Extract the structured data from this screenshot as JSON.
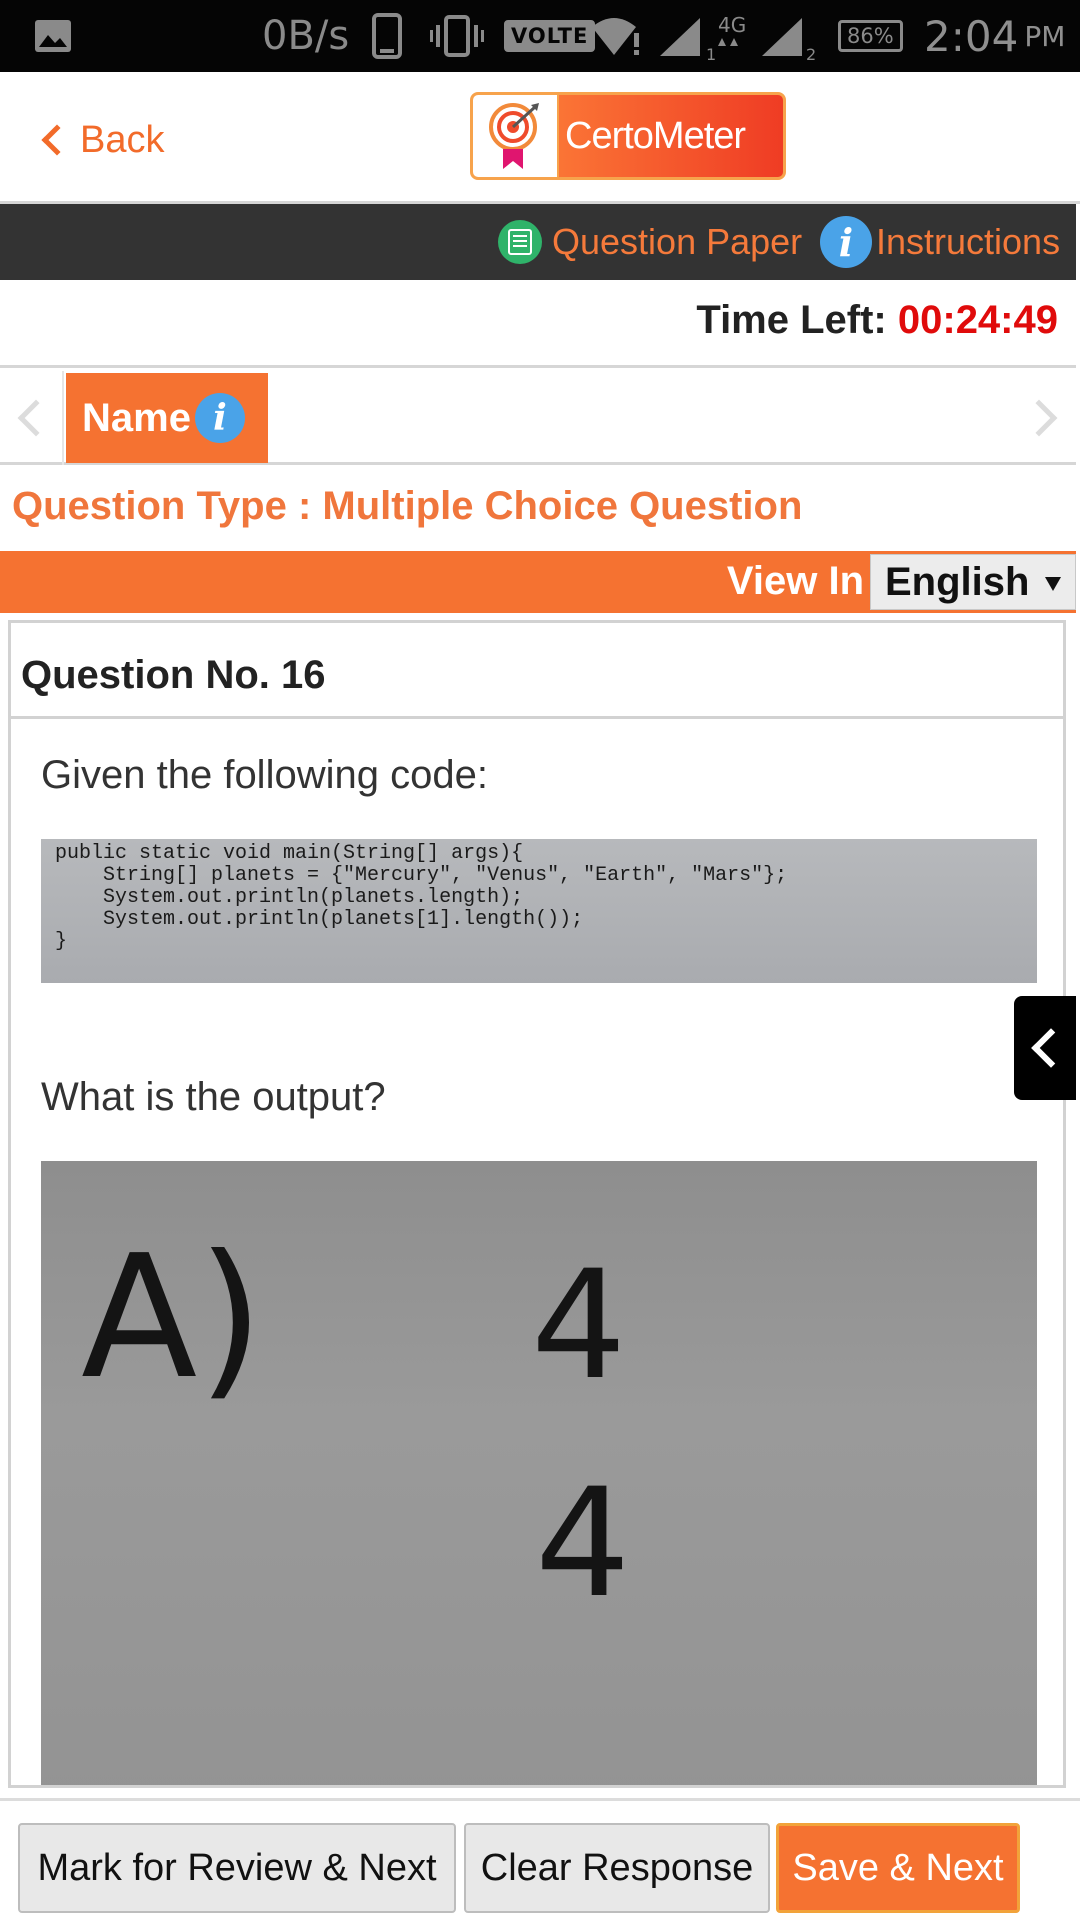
{
  "status_bar": {
    "speed": "0B/s",
    "volte": "VOLTE",
    "network": "4G",
    "sim1": "1",
    "sim2": "2",
    "battery": "86%",
    "time": "2:04",
    "ampm": "PM"
  },
  "header": {
    "back_label": "Back",
    "logo_text": "CertoMeter",
    "brand_color": "#f57231"
  },
  "toolbar": {
    "question_paper_label": "Question Paper",
    "instructions_label": "Instructions"
  },
  "timer": {
    "label": "Time Left:",
    "value": "00:24:49"
  },
  "section": {
    "tab_label": "Name"
  },
  "question_type": "Question Type : Multiple Choice Question",
  "view_in": {
    "label": "View In",
    "selected_language": "English"
  },
  "question": {
    "number_label": "Question No. 16",
    "intro_text": "Given the following code:",
    "code_lines": [
      "public static void main(String[] args){",
      "    String[] planets = {\"Mercury\", \"Venus\", \"Earth\", \"Mars\"};",
      "",
      "    System.out.println(planets.length);",
      "    System.out.println(planets[1].length());",
      "}"
    ],
    "prompt_text": "What is the output?",
    "answer_option": {
      "letter": "A)",
      "line1": "4",
      "line2": "4"
    }
  },
  "actions": {
    "mark_review_label": "Mark for Review & Next",
    "clear_label": "Clear Response",
    "save_label": "Save & Next"
  }
}
